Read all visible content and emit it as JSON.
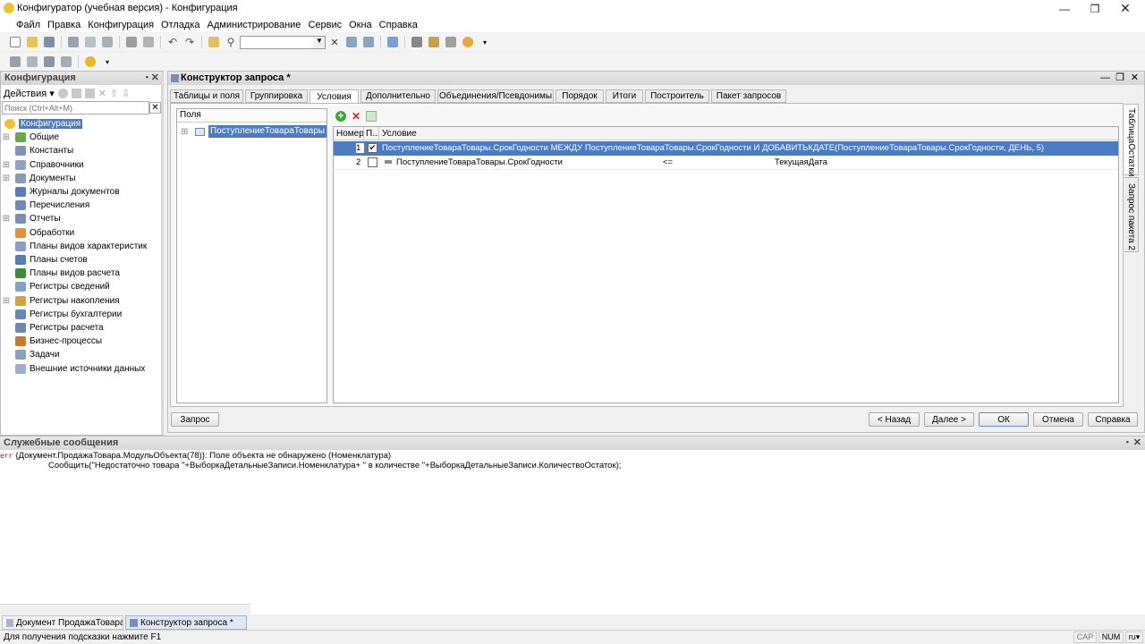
{
  "window": {
    "title": "Конфигуратор (учебная версия) - Конфигурация"
  },
  "menu": [
    "Файл",
    "Правка",
    "Конфигурация",
    "Отладка",
    "Администрирование",
    "Сервис",
    "Окна",
    "Справка"
  ],
  "toolbar": {
    "search_value": ""
  },
  "config_panel": {
    "title": "Конфигурация",
    "actions_label": "Действия",
    "search_placeholder": "Поиск (Ctrl+Alt+M)",
    "tree": [
      {
        "label": "Конфигурация",
        "icon": "config-icon",
        "expand": "",
        "selected": true,
        "root": true
      },
      {
        "label": "Общие",
        "icon": "common-icon",
        "expand": "⊞"
      },
      {
        "label": "Константы",
        "icon": "constants-icon",
        "expand": ""
      },
      {
        "label": "Справочники",
        "icon": "catalogs-icon",
        "expand": "⊞"
      },
      {
        "label": "Документы",
        "icon": "documents-icon",
        "expand": "⊞"
      },
      {
        "label": "Журналы документов",
        "icon": "journals-icon",
        "expand": ""
      },
      {
        "label": "Перечисления",
        "icon": "enums-icon",
        "expand": ""
      },
      {
        "label": "Отчеты",
        "icon": "reports-icon",
        "expand": "⊞"
      },
      {
        "label": "Обработки",
        "icon": "dataprocessors-icon",
        "expand": ""
      },
      {
        "label": "Планы видов характеристик",
        "icon": "chart-of-characteristic-types-icon",
        "expand": ""
      },
      {
        "label": "Планы счетов",
        "icon": "chart-of-accounts-icon",
        "expand": ""
      },
      {
        "label": "Планы видов расчета",
        "icon": "chart-of-calculation-types-icon",
        "expand": ""
      },
      {
        "label": "Регистры сведений",
        "icon": "information-registers-icon",
        "expand": ""
      },
      {
        "label": "Регистры накопления",
        "icon": "accumulation-registers-icon",
        "expand": "⊞"
      },
      {
        "label": "Регистры бухгалтерии",
        "icon": "accounting-registers-icon",
        "expand": ""
      },
      {
        "label": "Регистры расчета",
        "icon": "calculation-registers-icon",
        "expand": ""
      },
      {
        "label": "Бизнес-процессы",
        "icon": "business-processes-icon",
        "expand": ""
      },
      {
        "label": "Задачи",
        "icon": "tasks-icon",
        "expand": ""
      },
      {
        "label": "Внешние источники данных",
        "icon": "external-data-sources-icon",
        "expand": ""
      }
    ]
  },
  "designer": {
    "title": "Конструктор запроса *",
    "tabs": [
      "Таблицы и поля",
      "Группировка",
      "Условия",
      "Дополнительно",
      "Объединения/Псевдонимы",
      "Порядок",
      "Итоги",
      "Построитель",
      "Пакет запросов"
    ],
    "active_tab": 2,
    "side_tabs": [
      "ТаблицаОстатки",
      "Запрос пакета 2"
    ],
    "fields_header": "Поля",
    "fields_tree_item": "ПоступлениеТовараТовары",
    "conditions_columns": [
      "Номер",
      "П...",
      "Условие"
    ],
    "conditions": [
      {
        "num": "1",
        "checked": true,
        "text": "ПоступлениеТовараТовары.СрокГодности МЕЖДУ ПоступлениеТовараТовары.СрокГодности И ДОБАВИТЬКДАТЕ(ПоступлениеТовараТовары.СрокГодности, ДЕНЬ, 5)",
        "operator": "",
        "value": ""
      },
      {
        "num": "2",
        "checked": false,
        "text": "ПоступлениеТовараТовары.СрокГодности",
        "operator": "<=",
        "value": "ТекущаяДата"
      }
    ],
    "buttons": {
      "query": "Запрос",
      "back": "< Назад",
      "next": "Далее >",
      "ok": "ОК",
      "cancel": "Отмена",
      "help": "Справка"
    }
  },
  "messages": {
    "title": "Служебные сообщения",
    "err_tag": "err",
    "line1": "{Документ.ПродажаТовара.МодульОбъекта(78)}: Поле объекта не обнаружено (Номенклатура)",
    "line2": "Сообщить(\"Недостаточно товара  \"+ВыборкаДетальныеЗаписи.Номенклатура+ \" в количестве  \"+ВыборкаДетальныеЗаписи.КоличествоОстаток);"
  },
  "taskbar": [
    "Документ ПродажаТовара: ...",
    "Конструктор запроса *"
  ],
  "status": {
    "hint": "Для получения подсказки нажмите F1",
    "cap": "CAP",
    "num": "NUM",
    "lang": "ru"
  }
}
